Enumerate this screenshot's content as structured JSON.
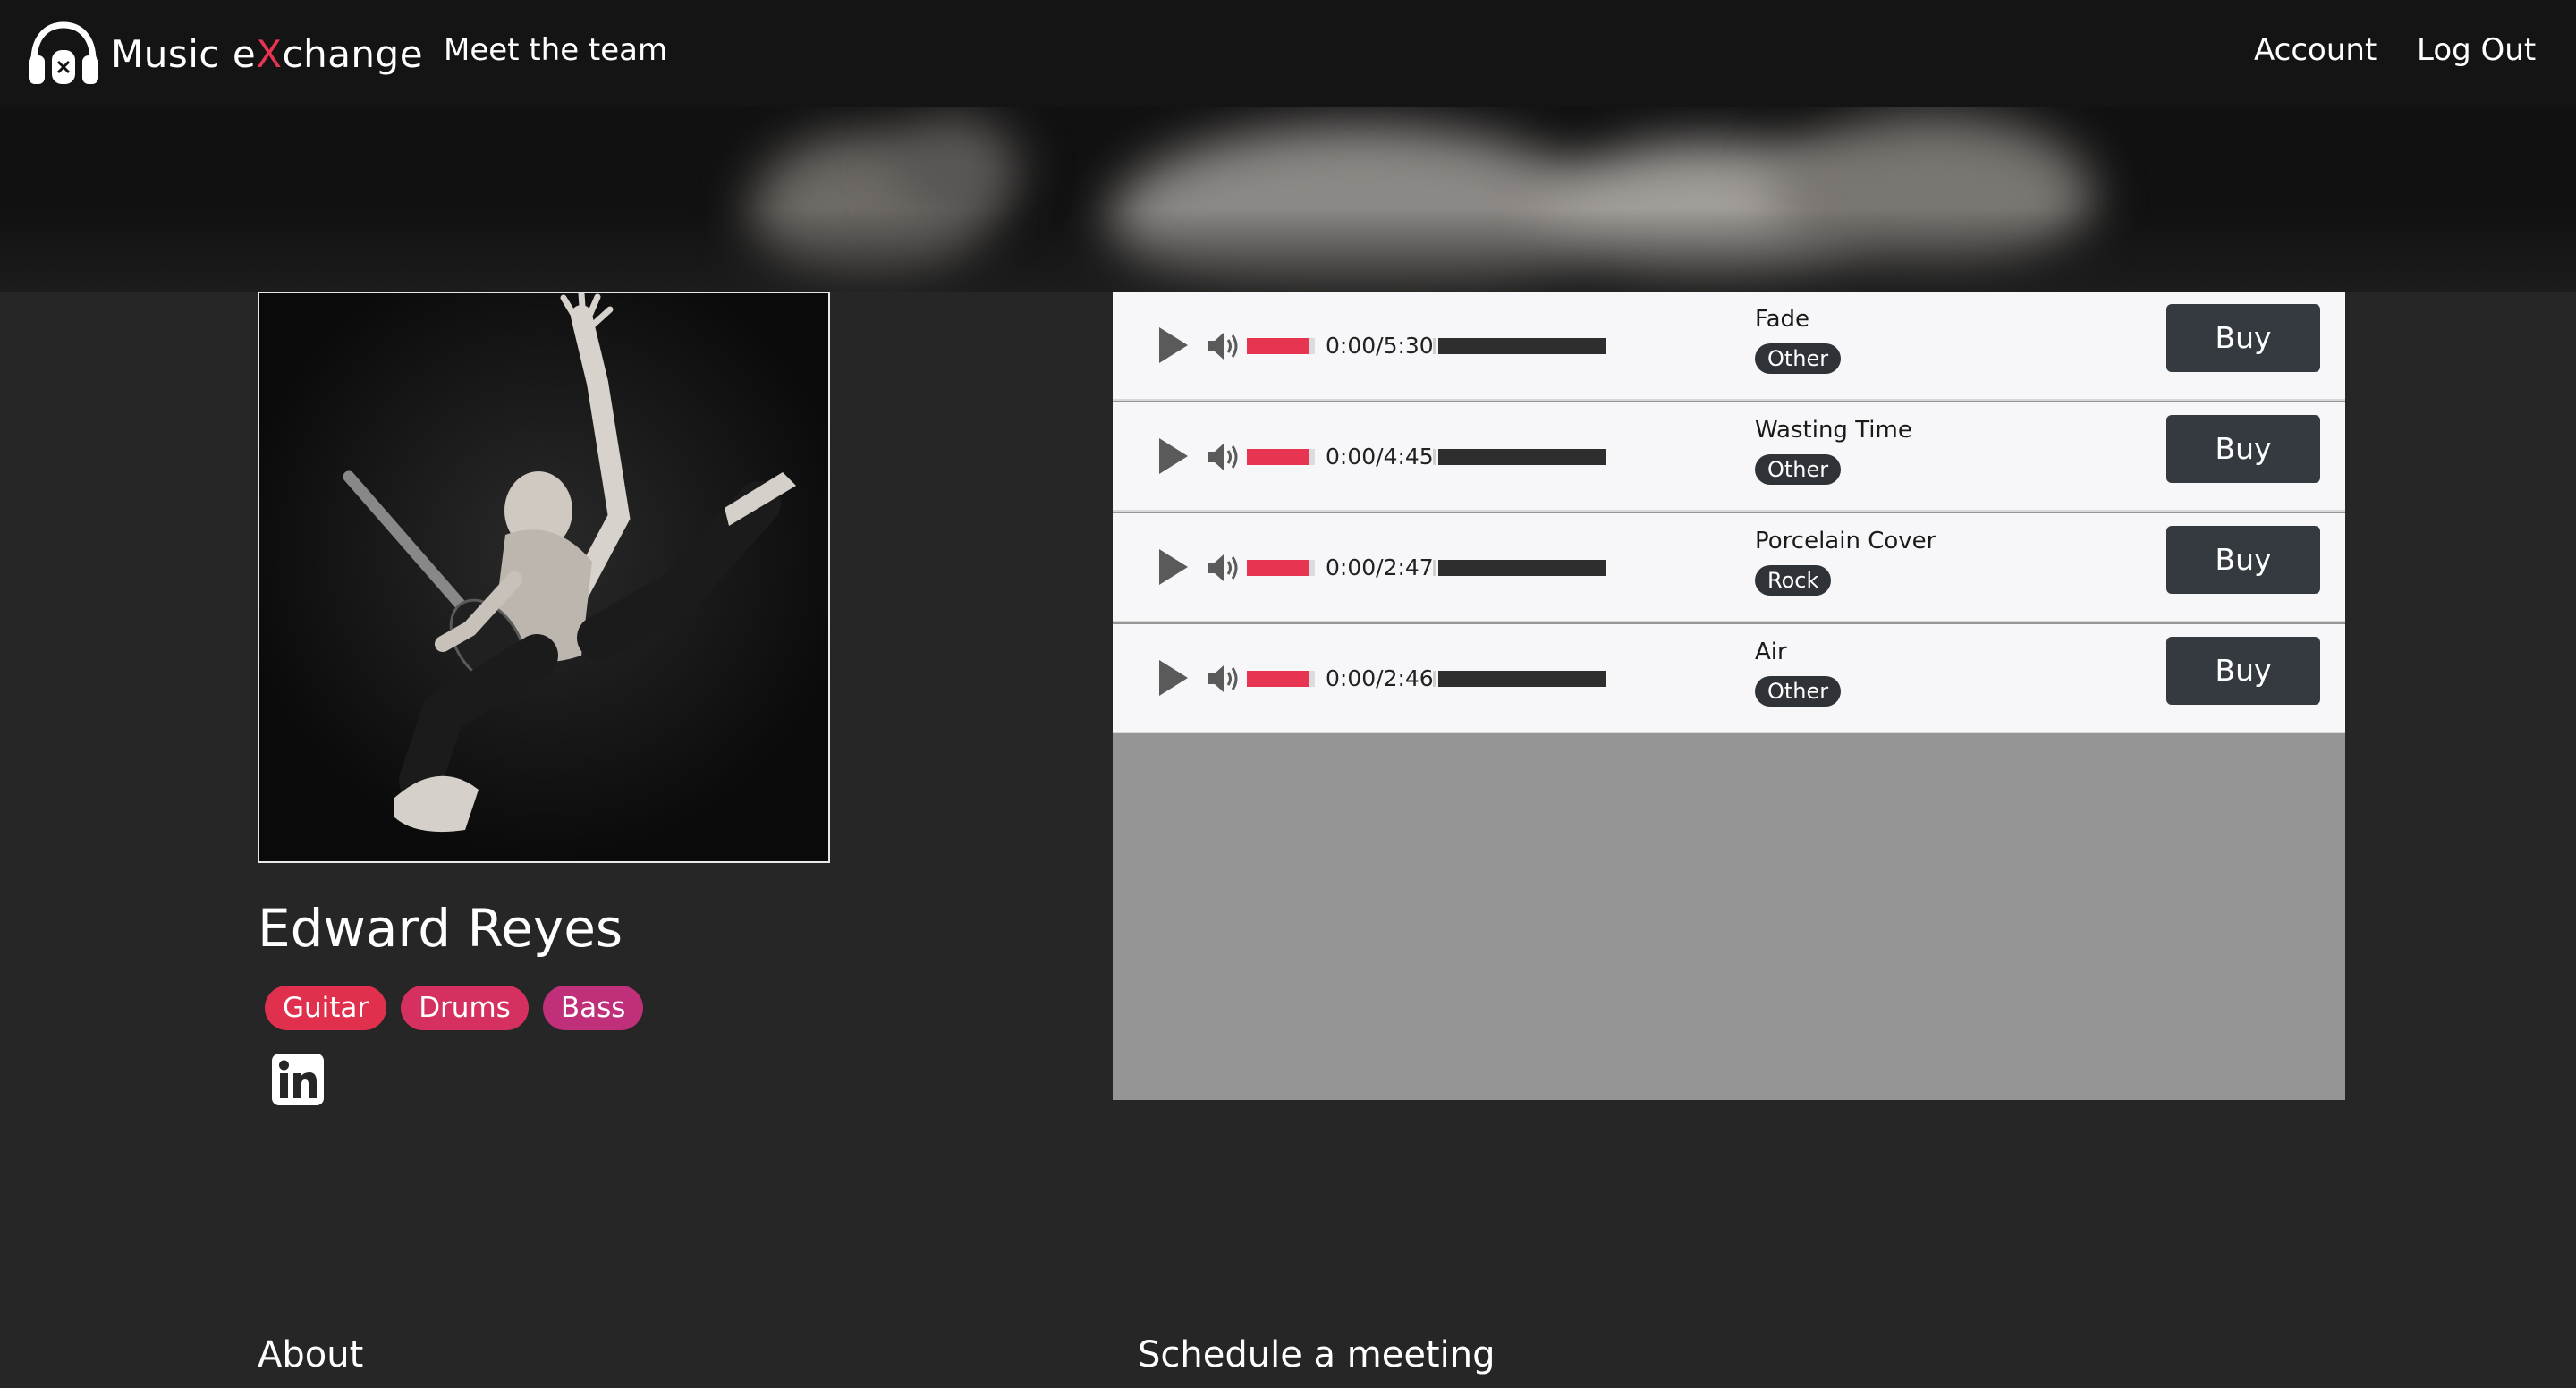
{
  "nav": {
    "brand_prefix": "Music e",
    "brand_x": "X",
    "brand_suffix": "change",
    "meet_team": "Meet the team",
    "account": "Account",
    "logout": "Log Out"
  },
  "profile": {
    "name": "Edward Reyes",
    "instruments": [
      "Guitar",
      "Drums",
      "Bass"
    ],
    "social_icon": "linkedin-icon"
  },
  "tracks": [
    {
      "title": "Fade",
      "genre": "Other",
      "time": "0:00/5:30",
      "buy_label": "Buy"
    },
    {
      "title": "Wasting Time",
      "genre": "Other",
      "time": "0:00/4:45",
      "buy_label": "Buy"
    },
    {
      "title": "Porcelain Cover",
      "genre": "Rock",
      "time": "0:00/2:47",
      "buy_label": "Buy"
    },
    {
      "title": "Air",
      "genre": "Other",
      "time": "0:00/2:46",
      "buy_label": "Buy"
    }
  ],
  "sections": {
    "about": "About",
    "schedule": "Schedule a meeting"
  },
  "colors": {
    "accent": "#e63451",
    "navbar": "#141414",
    "page_bg": "#262626",
    "button": "#343a40"
  }
}
